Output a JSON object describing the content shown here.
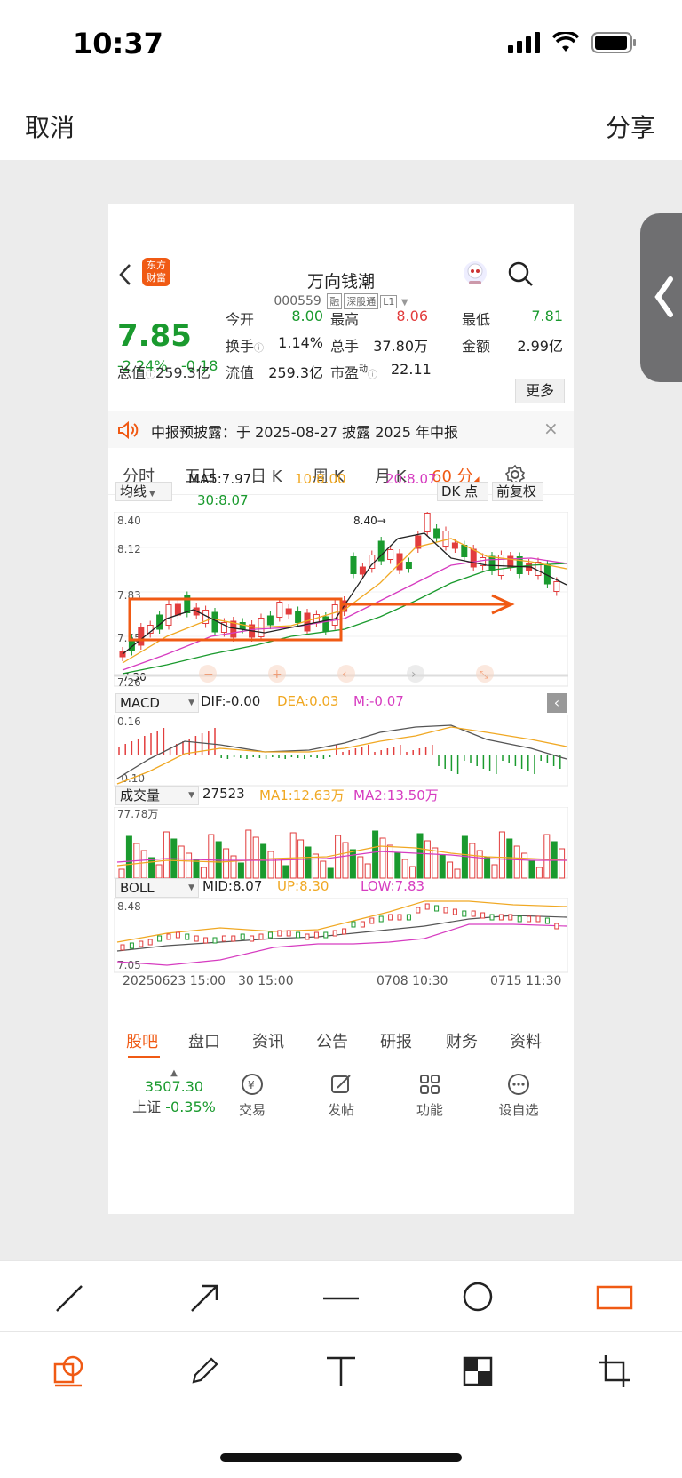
{
  "status_bar": {
    "time": "10:37"
  },
  "top_bar": {
    "cancel": "取消",
    "share": "分享"
  },
  "stock": {
    "name": "万向钱潮",
    "code": "000559",
    "tags": [
      "融",
      "深股通",
      "L1"
    ],
    "brand_line1": "东方",
    "brand_line2": "财富",
    "price": "7.85",
    "change_pct": "-2.24%",
    "change_abs": "-0.18",
    "quotes": {
      "open_label": "今开",
      "open": "8.00",
      "high_label": "最高",
      "high": "8.06",
      "low_label": "最低",
      "low": "7.81",
      "turnover_label": "换手",
      "turnover": "1.14%",
      "volume_label": "总手",
      "volume": "37.80万",
      "amount_label": "金额",
      "amount": "2.99亿",
      "mcap_label": "总值",
      "mcap": "259.3亿",
      "float_label": "流值",
      "float_cap": "259.3亿",
      "pe_label": "市盈",
      "pe_sup": "动",
      "pe": "22.11",
      "more": "更多"
    },
    "notice": "中报预披露：于 2025-08-27 披露 2025 年中报"
  },
  "period_tabs": [
    "分时",
    "五日",
    "日 K",
    "周 K",
    "月 K",
    "60 分"
  ],
  "indicators": {
    "ma_select": "均线",
    "ma5": "MA5:7.97",
    "ma10": "10:8.00",
    "ma20": "20:8.07",
    "ma30": "30:8.07",
    "dk": "DK 点",
    "adjust": "前复权",
    "price_ticks": [
      "8.40",
      "8.12",
      "7.83",
      "7.55",
      "7.26"
    ],
    "max_marker": "8.40→",
    "min_marker": "7.30",
    "macd_select": "MACD",
    "dif": "DIF:-0.00",
    "dea": "DEA:0.03",
    "m": "M:-0.07",
    "macd_ticks": [
      "0.16",
      "-0.10"
    ],
    "vol_select": "成交量",
    "vol_now": "27523",
    "vol_ma1": "MA1:12.63万",
    "vol_ma2": "MA2:13.50万",
    "vol_max": "77.78万",
    "boll_select": "BOLL",
    "mid": "MID:8.07",
    "up": "UP:8.30",
    "low": "LOW:7.83",
    "boll_ticks": [
      "8.48",
      "7.05"
    ],
    "time_start": "20250623 15:00",
    "time_mid1": "30 15:00",
    "time_mid2": "0708 10:30",
    "time_end": "0715 11:30"
  },
  "bottom_tabs": [
    "股吧",
    "盘口",
    "资讯",
    "公告",
    "研报",
    "财务",
    "资料"
  ],
  "dock": {
    "index_value": "3507.30",
    "index_name": "上证",
    "index_change": "-0.35%",
    "trade": "交易",
    "post": "发帖",
    "functions": "功能",
    "watchlist": "设自选"
  },
  "colors": {
    "accent": "#f05a14",
    "up": "#e23d3d",
    "down": "#1a9a2e",
    "stage": "#ececec"
  }
}
